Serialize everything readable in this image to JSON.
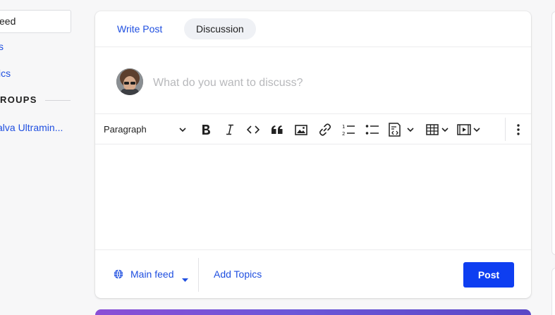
{
  "sidebar": {
    "feed_label": "eed",
    "link_1": "s",
    "link_2": "ics",
    "groups_heading": "ROUPS",
    "group_item": "alva Ultramin..."
  },
  "tabs": {
    "write_post": "Write Post",
    "discussion": "Discussion"
  },
  "composer": {
    "placeholder": "What do you want to discuss?"
  },
  "toolbar": {
    "paragraph": "Paragraph",
    "tools": [
      "chevron-down-icon",
      "bold-icon",
      "italic-icon",
      "code-icon",
      "quote-icon",
      "image-icon",
      "link-icon",
      "ordered-list-icon",
      "bullet-list-icon",
      "code-block-icon",
      "table-icon",
      "video-icon",
      "more-vertical-icon"
    ]
  },
  "footer": {
    "feed_select": "Main feed",
    "add_topics": "Add Topics",
    "post": "Post"
  },
  "colors": {
    "accent": "#1f4fe0",
    "post_button": "#0e3ef1",
    "tab_active_bg": "#eff1f5"
  }
}
